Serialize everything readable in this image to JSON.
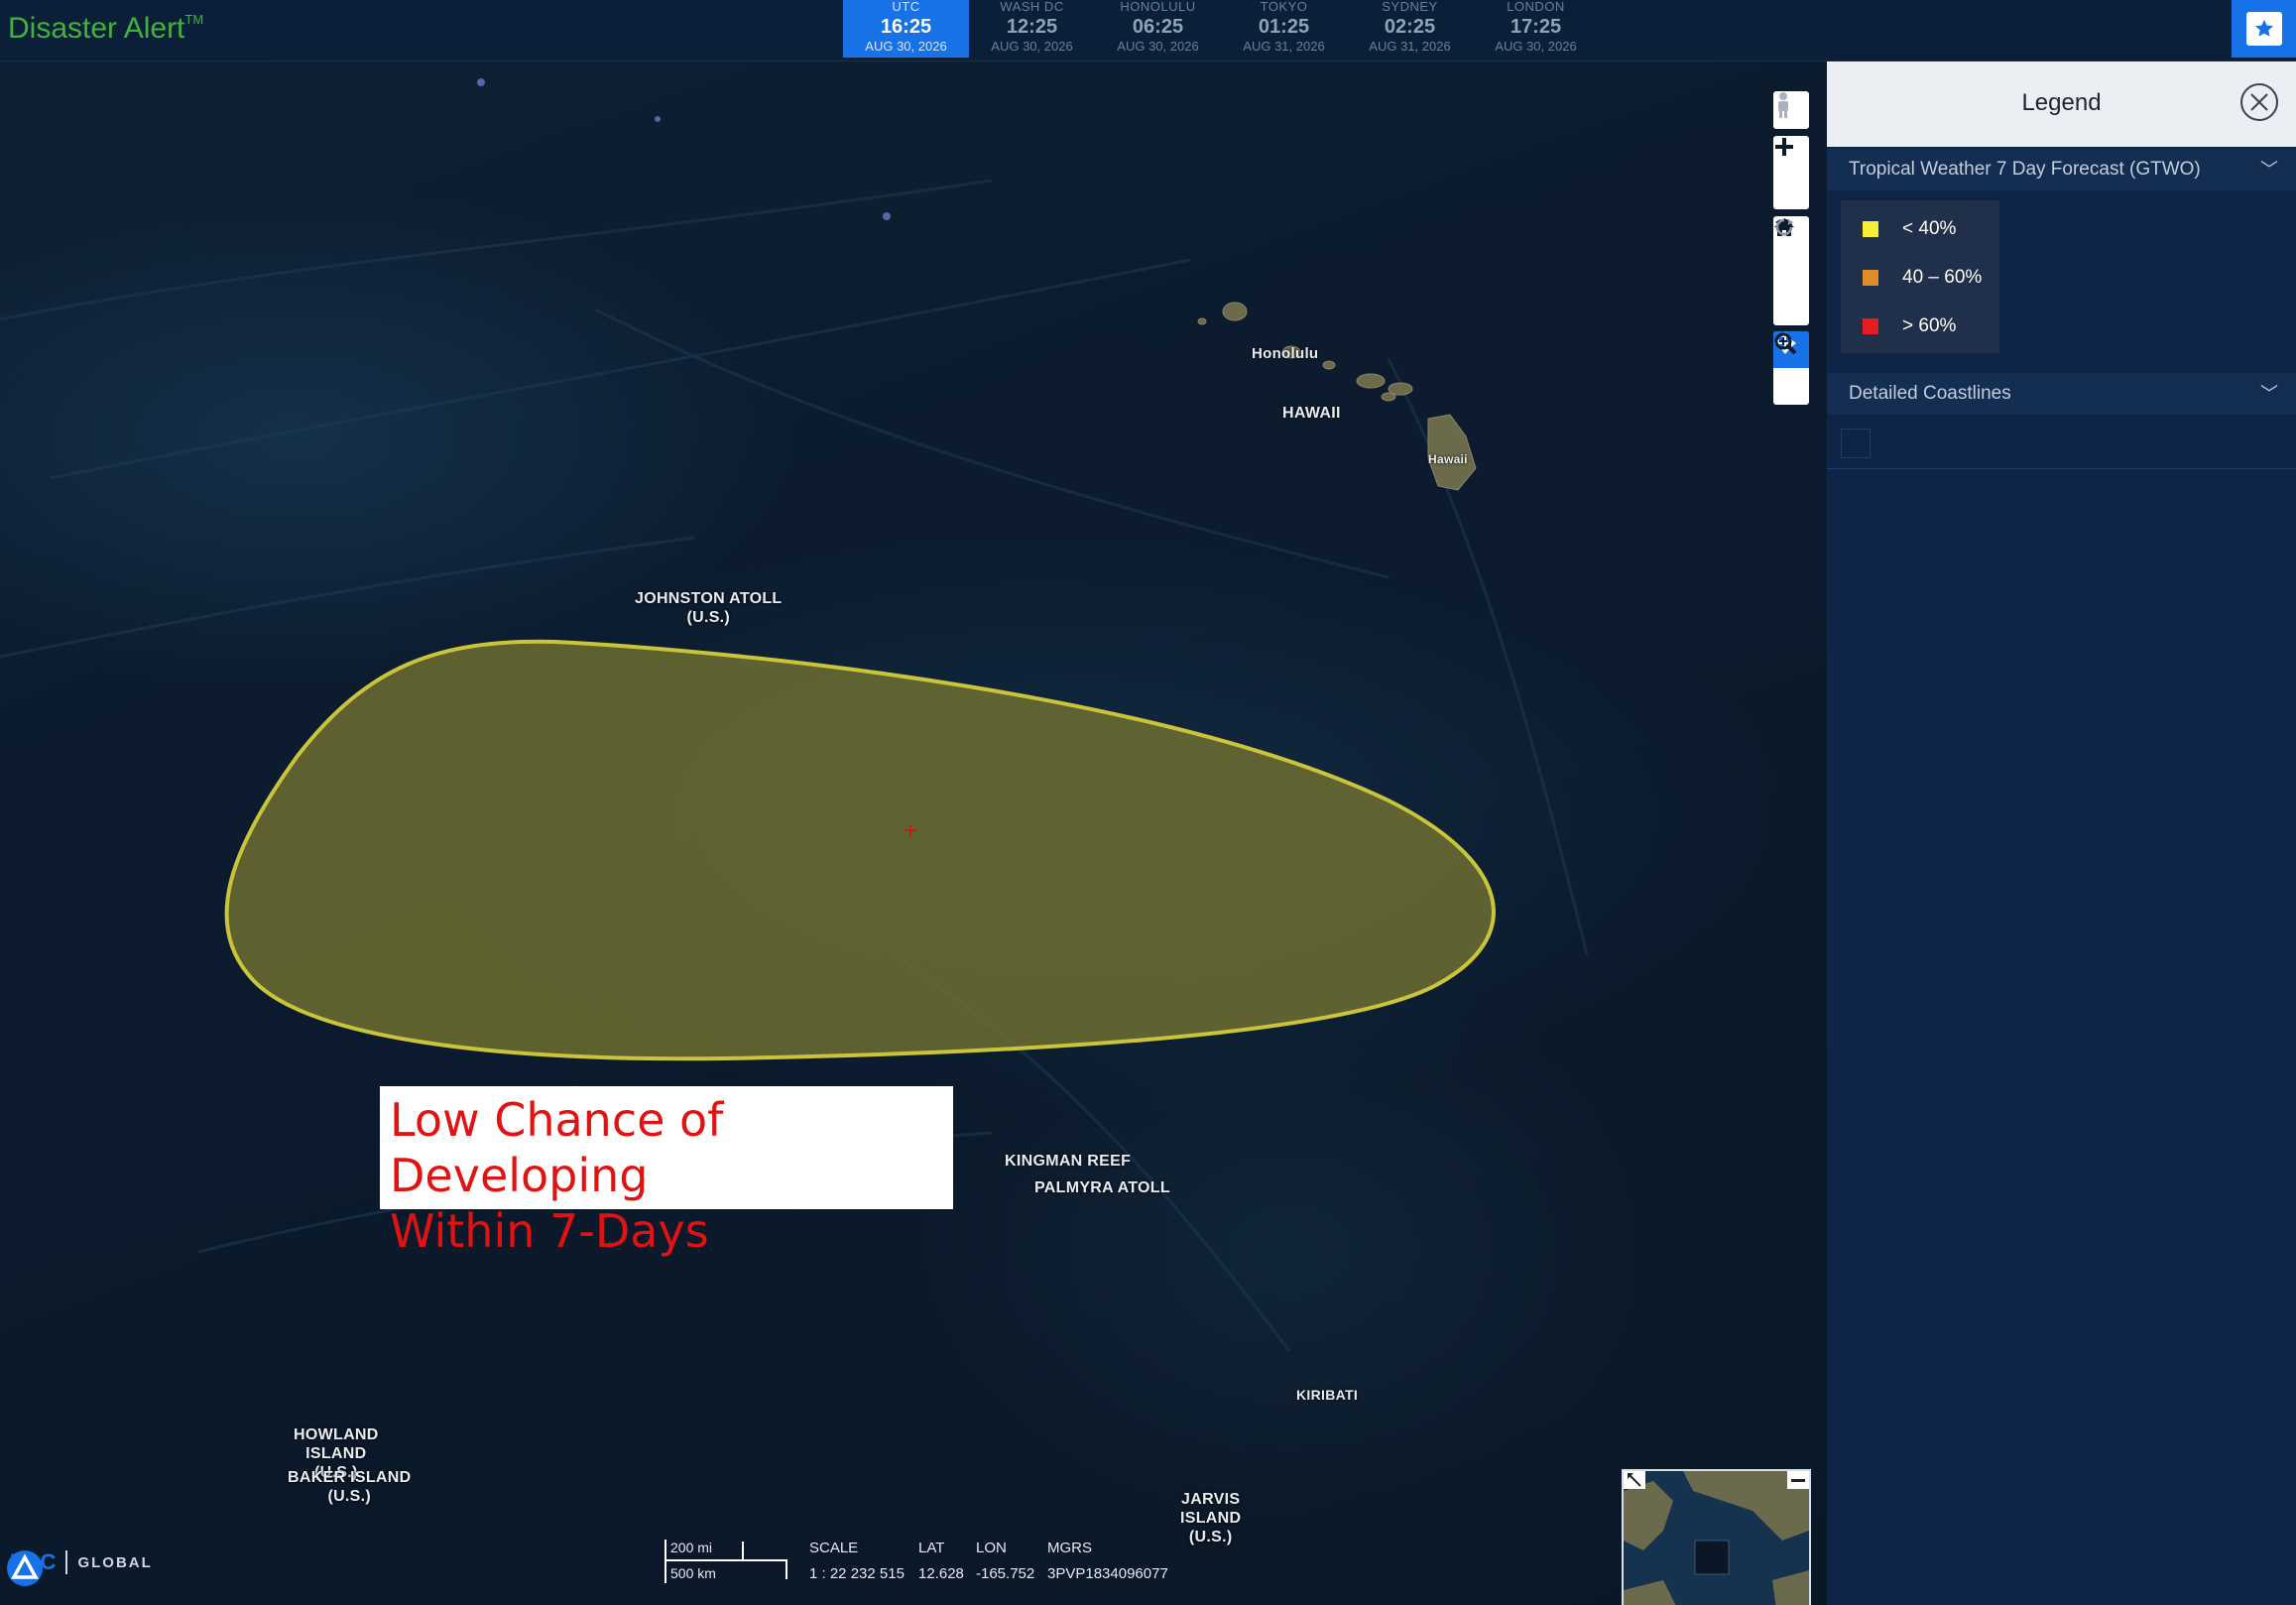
{
  "app": {
    "title": "Disaster Alert",
    "trademark": "TM"
  },
  "clocks": [
    {
      "zone": "UTC",
      "time": "16:25",
      "date": "AUG 30, 2026",
      "active": true
    },
    {
      "zone": "WASH DC",
      "time": "12:25",
      "date": "AUG 30, 2026",
      "active": false
    },
    {
      "zone": "HONOLULU",
      "time": "06:25",
      "date": "AUG 30, 2026",
      "active": false
    },
    {
      "zone": "TOKYO",
      "time": "01:25",
      "date": "AUG 31, 2026",
      "active": false
    },
    {
      "zone": "SYDNEY",
      "time": "02:25",
      "date": "AUG 31, 2026",
      "active": false
    },
    {
      "zone": "LONDON",
      "time": "17:25",
      "date": "AUG 30, 2026",
      "active": false
    }
  ],
  "map": {
    "labels": {
      "honolulu": "Honolulu",
      "hawaii_upper": "HAWAII",
      "hawaii_island": "Hawaii",
      "johnston": "JOHNSTON ATOLL\n(U.S.)",
      "kingman": "KINGMAN REEF",
      "palmyra": "PALMYRA ATOLL",
      "kiribati": "KIRIBATI",
      "howland": "HOWLAND\nISLAND\n(U.S.)",
      "baker": "BAKER ISLAND\n(U.S.)",
      "jarvis": "JARVIS\nISLAND\n(U.S.)"
    },
    "annotation": "Low Chance of Developing\nWithin 7-Days",
    "forecast_area_color": "#c9c43a"
  },
  "tools": [
    "pegman-icon",
    "zoom-in-icon",
    "zoom-out-icon",
    "home-icon",
    "rotate-left-icon",
    "rotate-right-icon",
    "pan-icon",
    "zoom-box-icon"
  ],
  "scale": {
    "miles": "200 mi",
    "km": "500 km"
  },
  "readout": {
    "scale_label": "SCALE",
    "scale_value": "1 : 22 232 515",
    "lat_label": "LAT",
    "lat_value": "12.628",
    "lon_label": "LON",
    "lon_value": "-165.752",
    "mgrs_label": "MGRS",
    "mgrs_value": "3PVP1834096077"
  },
  "brand": {
    "name": "PDC",
    "suffix": "GLOBAL"
  },
  "legend": {
    "title": "Legend",
    "section1": "Tropical Weather 7 Day Forecast (GTWO)",
    "items": [
      {
        "label": "< 40%",
        "color": "#f5ef38"
      },
      {
        "label": "40 – 60%",
        "color": "#e08a2a"
      },
      {
        "label": "> 60%",
        "color": "#e61e1e"
      }
    ],
    "section2": "Detailed Coastlines"
  }
}
